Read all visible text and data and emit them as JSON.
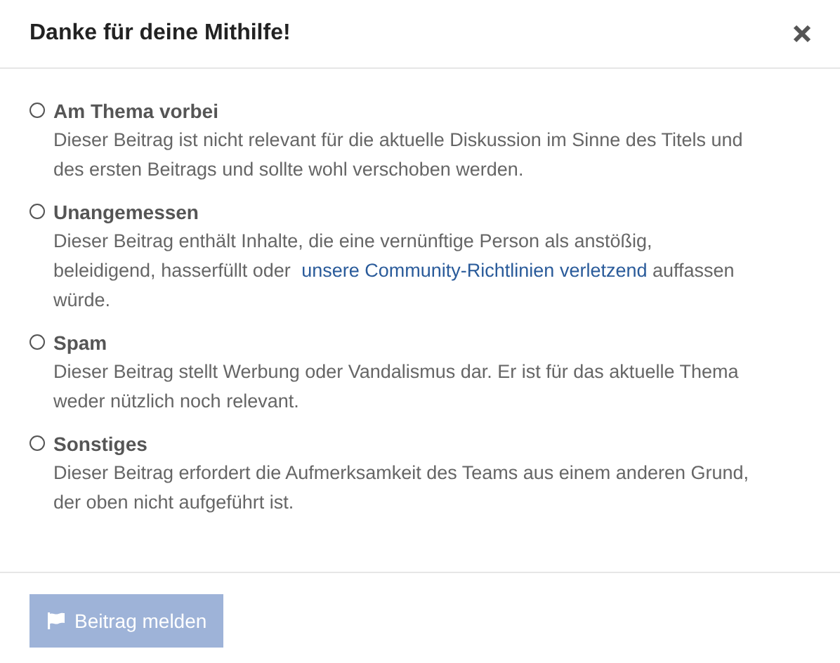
{
  "dialog": {
    "title": "Danke für deine Mithilfe!"
  },
  "options": [
    {
      "label": "Am Thema vorbei",
      "selected": false,
      "description": "Dieser Beitrag ist nicht relevant für die aktuelle Diskussion im Sinne des Titels und des ersten Beitrags und sollte wohl verschoben werden."
    },
    {
      "label": "Unangemessen",
      "selected": false,
      "description": "Dieser Beitrag enthält Inhalte, die eine vernünftige Person als anstößig, beleidigend, hasserfüllt oder ",
      "link": "unsere Community-Richtlinien verletzend",
      "description_after": " auffassen würde."
    },
    {
      "label": "Spam",
      "selected": false,
      "description": "Dieser Beitrag stellt Werbung oder Vandalismus dar. Er ist für das aktuelle Thema weder nützlich noch relevant."
    },
    {
      "label": "Sonstiges",
      "selected": false,
      "description": "Dieser Beitrag erfordert die Aufmerksamkeit des Teams aus einem anderen Grund, der oben nicht aufgeführt ist."
    }
  ],
  "submit": {
    "label": "Beitrag melden",
    "disabled": true
  }
}
